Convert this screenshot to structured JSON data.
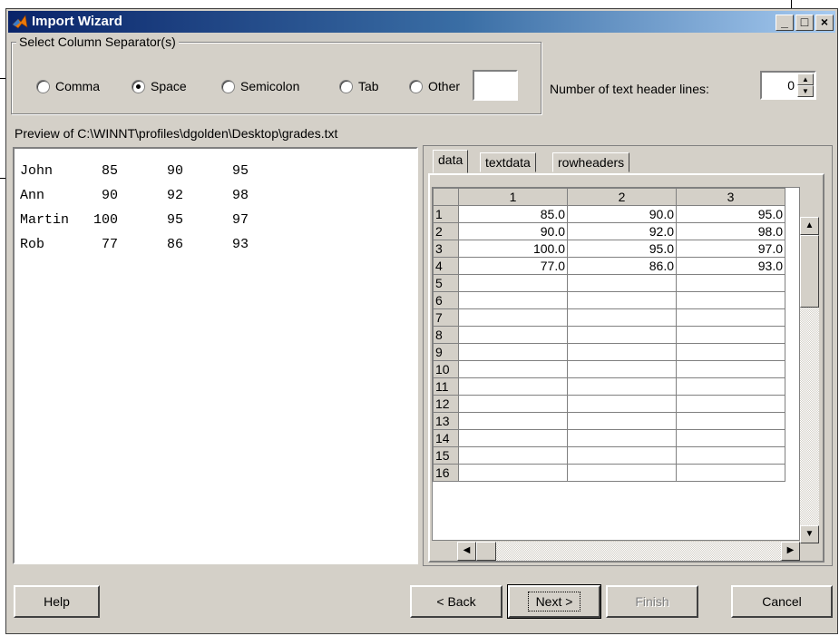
{
  "window": {
    "title": "Import Wizard",
    "controls": {
      "minimize": "_",
      "maximize": "□",
      "close": "×"
    }
  },
  "separators": {
    "group_label": "Select Column Separator(s)",
    "options": [
      {
        "label": "Comma",
        "checked": false
      },
      {
        "label": "Space",
        "checked": true
      },
      {
        "label": "Semicolon",
        "checked": false
      },
      {
        "label": "Tab",
        "checked": false
      },
      {
        "label": "Other",
        "checked": false
      }
    ],
    "other_value": ""
  },
  "header_lines": {
    "label": "Number of text header lines:",
    "value": "0"
  },
  "preview": {
    "label": "Preview of C:\\WINNT\\profiles\\dgolden\\Desktop\\grades.txt",
    "lines": [
      "John      85      90      95",
      "Ann       90      92      98",
      "Martin   100      95      97",
      "Rob       77      86      93"
    ]
  },
  "tabs": [
    "data",
    "textdata",
    "rowheaders"
  ],
  "grid": {
    "columns": [
      "1",
      "2",
      "3"
    ],
    "rows": [
      {
        "n": "1",
        "cells": [
          "85.0",
          "90.0",
          "95.0"
        ]
      },
      {
        "n": "2",
        "cells": [
          "90.0",
          "92.0",
          "98.0"
        ]
      },
      {
        "n": "3",
        "cells": [
          "100.0",
          "95.0",
          "97.0"
        ]
      },
      {
        "n": "4",
        "cells": [
          "77.0",
          "86.0",
          "93.0"
        ]
      },
      {
        "n": "5",
        "cells": [
          "",
          "",
          ""
        ]
      },
      {
        "n": "6",
        "cells": [
          "",
          "",
          ""
        ]
      },
      {
        "n": "7",
        "cells": [
          "",
          "",
          ""
        ]
      },
      {
        "n": "8",
        "cells": [
          "",
          "",
          ""
        ]
      },
      {
        "n": "9",
        "cells": [
          "",
          "",
          ""
        ]
      },
      {
        "n": "10",
        "cells": [
          "",
          "",
          ""
        ]
      },
      {
        "n": "11",
        "cells": [
          "",
          "",
          ""
        ]
      },
      {
        "n": "12",
        "cells": [
          "",
          "",
          ""
        ]
      },
      {
        "n": "13",
        "cells": [
          "",
          "",
          ""
        ]
      },
      {
        "n": "14",
        "cells": [
          "",
          "",
          ""
        ]
      },
      {
        "n": "15",
        "cells": [
          "",
          "",
          ""
        ]
      },
      {
        "n": "16",
        "cells": [
          "",
          "",
          ""
        ]
      }
    ]
  },
  "buttons": {
    "help": "Help",
    "back": "< Back",
    "next": "Next >",
    "finish": "Finish",
    "cancel": "Cancel"
  },
  "colors": {
    "title_start": "#0a246a",
    "title_end": "#a6caf0",
    "face": "#d4d0c8"
  },
  "icons": [
    "matlab-icon",
    "minimize-icon",
    "maximize-icon",
    "close-icon",
    "spin-up-icon",
    "spin-down-icon",
    "scroll-up-icon",
    "scroll-down-icon",
    "scroll-left-icon",
    "scroll-right-icon"
  ]
}
